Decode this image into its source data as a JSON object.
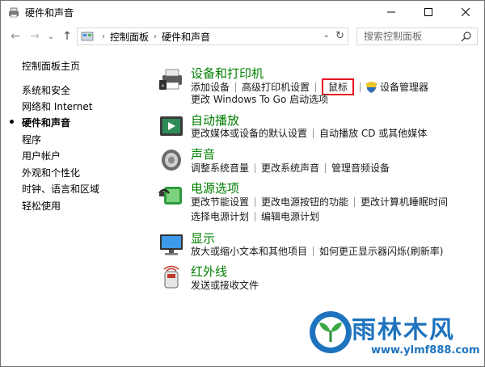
{
  "window": {
    "title": "硬件和声音"
  },
  "nav": {
    "crumbs": [
      "控制面板",
      "硬件和声音"
    ],
    "search_placeholder": "搜索控制面板"
  },
  "sidebar": {
    "items": [
      {
        "label": "控制面板主页"
      },
      {
        "label": "系统和安全"
      },
      {
        "label": "网络和 Internet"
      },
      {
        "label": "硬件和声音"
      },
      {
        "label": "程序"
      },
      {
        "label": "用户帐户"
      },
      {
        "label": "外观和个性化"
      },
      {
        "label": "时钟、语言和区域"
      },
      {
        "label": "轻松使用"
      }
    ],
    "active_index": 3
  },
  "categories": [
    {
      "title": "设备和打印机",
      "icon": "printer-icon",
      "rows": [
        [
          "添加设备",
          "高级打印机设置",
          "鼠标",
          "设备管理器"
        ],
        [
          "更改 Windows To Go 启动选项"
        ]
      ]
    },
    {
      "title": "自动播放",
      "icon": "autoplay-icon",
      "rows": [
        [
          "更改媒体或设备的默认设置",
          "自动播放 CD 或其他媒体"
        ]
      ]
    },
    {
      "title": "声音",
      "icon": "speaker-icon",
      "rows": [
        [
          "调整系统音量",
          "更改系统声音",
          "管理音频设备"
        ]
      ]
    },
    {
      "title": "电源选项",
      "icon": "power-options-icon",
      "rows": [
        [
          "更改节能设置",
          "更改电源按钮的功能",
          "更改计算机睡眠时间"
        ],
        [
          "选择电源计划",
          "编辑电源计划"
        ]
      ]
    },
    {
      "title": "显示",
      "icon": "monitor-icon",
      "rows": [
        [
          "放大或缩小文本和其他项目",
          "如何更正显示器闪烁(刷新率)"
        ]
      ]
    },
    {
      "title": "红外线",
      "icon": "infrared-icon",
      "rows": [
        [
          "发送或接收文件"
        ]
      ]
    }
  ],
  "watermark": {
    "text": "雨林木风",
    "url": "www.ylmf888.com"
  },
  "colors": {
    "category_title": "#008000",
    "highlight_border": "#e81123",
    "watermark": "#1e73be"
  }
}
